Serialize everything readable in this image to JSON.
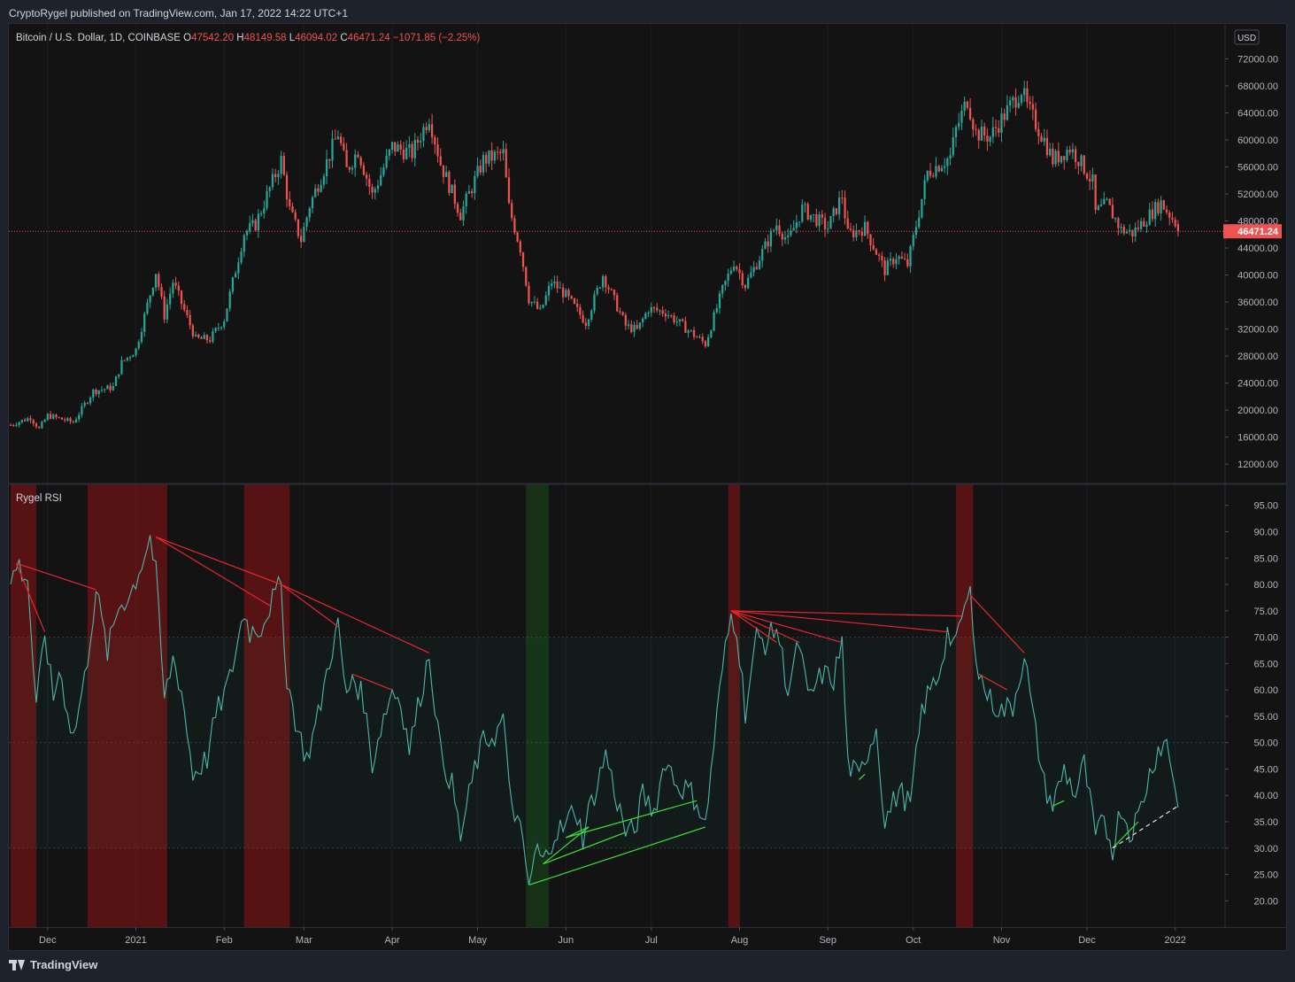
{
  "publish_line": "CryptoRygel published on TradingView.com, Jan 17, 2022 14:22 UTC+1",
  "footer_brand": "TradingView",
  "colors": {
    "up": "#26a69a",
    "down": "#ef5350",
    "rsi_line": "#4db6ac",
    "bear_div": "#e8262d",
    "bull_div": "#3be03b",
    "bg": "#131313"
  },
  "chart_data": [
    {
      "type": "candlestick",
      "symbol": "Bitcoin / U.S. Dollar, 1D, COINBASE",
      "ohlc_label": {
        "o": "47542.20",
        "h": "48149.58",
        "l": "46094.02",
        "c": "46471.24",
        "change": "−1071.85 (−2.25%)"
      },
      "currency": "USD",
      "last_price": "46471.24",
      "y_ticks": [
        "72000.00",
        "68000.00",
        "64000.00",
        "60000.00",
        "56000.00",
        "52000.00",
        "48000.00",
        "44000.00",
        "40000.00",
        "36000.00",
        "32000.00",
        "28000.00",
        "24000.00",
        "20000.00",
        "16000.00",
        "12000.00"
      ],
      "ylim": [
        11500,
        73500
      ],
      "x_range": [
        "2020-11-18",
        "2022-01-07"
      ],
      "anchors": [
        [
          "2020-11-18",
          17800
        ],
        [
          "2020-11-25",
          18900
        ],
        [
          "2020-11-28",
          17200
        ],
        [
          "2020-12-01",
          19200
        ],
        [
          "2020-12-10",
          18200
        ],
        [
          "2020-12-17",
          22800
        ],
        [
          "2020-12-24",
          23400
        ],
        [
          "2020-12-27",
          27000
        ],
        [
          "2021-01-01",
          29000
        ],
        [
          "2021-01-08",
          40500
        ],
        [
          "2021-01-11",
          34000
        ],
        [
          "2021-01-14",
          39000
        ],
        [
          "2021-01-22",
          30500
        ],
        [
          "2021-01-27",
          30500
        ],
        [
          "2021-02-01",
          33500
        ],
        [
          "2021-02-08",
          46200
        ],
        [
          "2021-02-12",
          47500
        ],
        [
          "2021-02-21",
          57000
        ],
        [
          "2021-02-24",
          49600
        ],
        [
          "2021-02-28",
          45200
        ],
        [
          "2021-03-03",
          50300
        ],
        [
          "2021-03-13",
          61000
        ],
        [
          "2021-03-16",
          55500
        ],
        [
          "2021-03-20",
          58500
        ],
        [
          "2021-03-25",
          51800
        ],
        [
          "2021-04-01",
          59000
        ],
        [
          "2021-04-08",
          58000
        ],
        [
          "2021-04-14",
          63500
        ],
        [
          "2021-04-18",
          56500
        ],
        [
          "2021-04-25",
          49000
        ],
        [
          "2021-05-03",
          57000
        ],
        [
          "2021-05-10",
          58000
        ],
        [
          "2021-05-12",
          50000
        ],
        [
          "2021-05-16",
          44000
        ],
        [
          "2021-05-19",
          36500
        ],
        [
          "2021-05-23",
          34500
        ],
        [
          "2021-05-27",
          39000
        ],
        [
          "2021-06-01",
          37000
        ],
        [
          "2021-06-08",
          33000
        ],
        [
          "2021-06-14",
          40000
        ],
        [
          "2021-06-22",
          32500
        ],
        [
          "2021-06-26",
          31800
        ],
        [
          "2021-06-30",
          35000
        ],
        [
          "2021-07-06",
          34500
        ],
        [
          "2021-07-20",
          29800
        ],
        [
          "2021-07-26",
          37800
        ],
        [
          "2021-07-30",
          42000
        ],
        [
          "2021-08-03",
          38500
        ],
        [
          "2021-08-14",
          47500
        ],
        [
          "2021-08-18",
          45000
        ],
        [
          "2021-08-23",
          49800
        ],
        [
          "2021-09-01",
          47000
        ],
        [
          "2021-09-06",
          51800
        ],
        [
          "2021-09-08",
          46000
        ],
        [
          "2021-09-14",
          47000
        ],
        [
          "2021-09-21",
          40700
        ],
        [
          "2021-09-25",
          42800
        ],
        [
          "2021-09-29",
          41500
        ],
        [
          "2021-10-06",
          55200
        ],
        [
          "2021-10-14",
          57500
        ],
        [
          "2021-10-16",
          61500
        ],
        [
          "2021-10-20",
          66000
        ],
        [
          "2021-10-23",
          61000
        ],
        [
          "2021-10-28",
          60500
        ],
        [
          "2021-11-08",
          67500
        ],
        [
          "2021-11-10",
          64900
        ],
        [
          "2021-11-16",
          60000
        ],
        [
          "2021-11-19",
          57000
        ],
        [
          "2021-11-25",
          58800
        ],
        [
          "2021-11-28",
          57200
        ],
        [
          "2021-12-03",
          53700
        ],
        [
          "2021-12-04",
          49200
        ],
        [
          "2021-12-08",
          50500
        ],
        [
          "2021-12-13",
          46700
        ],
        [
          "2021-12-17",
          46200
        ],
        [
          "2021-12-27",
          50700
        ],
        [
          "2022-01-01",
          47800
        ],
        [
          "2022-01-02",
          46471
        ]
      ]
    },
    {
      "type": "line",
      "title": "Rygel RSI",
      "y_ticks": [
        "95.00",
        "90.00",
        "85.00",
        "80.00",
        "75.00",
        "70.00",
        "65.00",
        "60.00",
        "55.00",
        "50.00",
        "45.00",
        "40.00",
        "35.00",
        "30.00",
        "25.00",
        "20.00"
      ],
      "ylim": [
        16.7,
        97.3
      ],
      "overbought": 70,
      "midline": 50,
      "oversold": 30,
      "x_ticks": [
        "Dec",
        "2021",
        "Feb",
        "Mar",
        "Apr",
        "May",
        "Jun",
        "Jul",
        "Aug",
        "Sep",
        "Oct",
        "Nov",
        "Dec",
        "2022"
      ],
      "x_tick_dates": [
        "2020-12-01",
        "2021-01-01",
        "2021-02-01",
        "2021-03-01",
        "2021-04-01",
        "2021-05-01",
        "2021-06-01",
        "2021-07-01",
        "2021-08-01",
        "2021-09-01",
        "2021-10-01",
        "2021-11-01",
        "2021-12-01",
        "2022-01-01"
      ],
      "anchors": [
        [
          "2020-11-18",
          80
        ],
        [
          "2020-11-20",
          84
        ],
        [
          "2020-11-24",
          81
        ],
        [
          "2020-11-27",
          56
        ],
        [
          "2020-11-30",
          71
        ],
        [
          "2020-12-03",
          58
        ],
        [
          "2020-12-05",
          64
        ],
        [
          "2020-12-10",
          51
        ],
        [
          "2020-12-14",
          62
        ],
        [
          "2020-12-18",
          79
        ],
        [
          "2020-12-22",
          67
        ],
        [
          "2020-12-26",
          76
        ],
        [
          "2020-12-30",
          78
        ],
        [
          "2021-01-03",
          84
        ],
        [
          "2021-01-06",
          89
        ],
        [
          "2021-01-08",
          82
        ],
        [
          "2021-01-11",
          58
        ],
        [
          "2021-01-14",
          66
        ],
        [
          "2021-01-17",
          60
        ],
        [
          "2021-01-21",
          44
        ],
        [
          "2021-01-26",
          47
        ],
        [
          "2021-01-29",
          55
        ],
        [
          "2021-02-03",
          62
        ],
        [
          "2021-02-08",
          75
        ],
        [
          "2021-02-10",
          71
        ],
        [
          "2021-02-14",
          72
        ],
        [
          "2021-02-17",
          76
        ],
        [
          "2021-02-21",
          80
        ],
        [
          "2021-02-23",
          62
        ],
        [
          "2021-02-27",
          52
        ],
        [
          "2021-03-02",
          47
        ],
        [
          "2021-03-06",
          55
        ],
        [
          "2021-03-10",
          66
        ],
        [
          "2021-03-13",
          72
        ],
        [
          "2021-03-16",
          58
        ],
        [
          "2021-03-18",
          63
        ],
        [
          "2021-03-22",
          58
        ],
        [
          "2021-03-25",
          46
        ],
        [
          "2021-03-28",
          53
        ],
        [
          "2021-04-01",
          60
        ],
        [
          "2021-04-04",
          58
        ],
        [
          "2021-04-07",
          49
        ],
        [
          "2021-04-11",
          59
        ],
        [
          "2021-04-14",
          67
        ],
        [
          "2021-04-18",
          48
        ],
        [
          "2021-04-22",
          42
        ],
        [
          "2021-04-25",
          32
        ],
        [
          "2021-04-30",
          45
        ],
        [
          "2021-05-03",
          50
        ],
        [
          "2021-05-08",
          52
        ],
        [
          "2021-05-10",
          55
        ],
        [
          "2021-05-12",
          41
        ],
        [
          "2021-05-16",
          33
        ],
        [
          "2021-05-19",
          23
        ],
        [
          "2021-05-22",
          30
        ],
        [
          "2021-05-24",
          27
        ],
        [
          "2021-05-28",
          33
        ],
        [
          "2021-06-01",
          34
        ],
        [
          "2021-06-04",
          38
        ],
        [
          "2021-06-07",
          32
        ],
        [
          "2021-06-09",
          37
        ],
        [
          "2021-06-12",
          42
        ],
        [
          "2021-06-15",
          48
        ],
        [
          "2021-06-18",
          41
        ],
        [
          "2021-06-22",
          33
        ],
        [
          "2021-06-25",
          33
        ],
        [
          "2021-06-28",
          40
        ],
        [
          "2021-07-02",
          37
        ],
        [
          "2021-07-06",
          47
        ],
        [
          "2021-07-10",
          42
        ],
        [
          "2021-07-14",
          41
        ],
        [
          "2021-07-17",
          39
        ],
        [
          "2021-07-20",
          34
        ],
        [
          "2021-07-23",
          50
        ],
        [
          "2021-07-26",
          64
        ],
        [
          "2021-07-29",
          74
        ],
        [
          "2021-07-31",
          72
        ],
        [
          "2021-08-03",
          56
        ],
        [
          "2021-08-07",
          70
        ],
        [
          "2021-08-10",
          69
        ],
        [
          "2021-08-14",
          72
        ],
        [
          "2021-08-18",
          60
        ],
        [
          "2021-08-22",
          69
        ],
        [
          "2021-08-25",
          58
        ],
        [
          "2021-08-30",
          63
        ],
        [
          "2021-09-03",
          62
        ],
        [
          "2021-09-06",
          69
        ],
        [
          "2021-09-08",
          46
        ],
        [
          "2021-09-12",
          43
        ],
        [
          "2021-09-14",
          47
        ],
        [
          "2021-09-18",
          53
        ],
        [
          "2021-09-21",
          35
        ],
        [
          "2021-09-26",
          41
        ],
        [
          "2021-09-30",
          38
        ],
        [
          "2021-10-04",
          56
        ],
        [
          "2021-10-07",
          60
        ],
        [
          "2021-10-10",
          63
        ],
        [
          "2021-10-13",
          71
        ],
        [
          "2021-10-16",
          68
        ],
        [
          "2021-10-18",
          74
        ],
        [
          "2021-10-21",
          78
        ],
        [
          "2021-10-24",
          63
        ],
        [
          "2021-10-28",
          58
        ],
        [
          "2021-11-01",
          56
        ],
        [
          "2021-11-05",
          57
        ],
        [
          "2021-11-09",
          67
        ],
        [
          "2021-11-12",
          55
        ],
        [
          "2021-11-16",
          42
        ],
        [
          "2021-11-19",
          38
        ],
        [
          "2021-11-23",
          45
        ],
        [
          "2021-11-27",
          40
        ],
        [
          "2021-11-30",
          46
        ],
        [
          "2021-12-04",
          32
        ],
        [
          "2021-12-07",
          35
        ],
        [
          "2021-12-10",
          30
        ],
        [
          "2021-12-13",
          38
        ],
        [
          "2021-12-16",
          33
        ],
        [
          "2021-12-19",
          36
        ],
        [
          "2021-12-23",
          44
        ],
        [
          "2021-12-26",
          49
        ],
        [
          "2021-12-29",
          50
        ],
        [
          "2022-01-01",
          42
        ],
        [
          "2022-01-02",
          38
        ]
      ],
      "overbought_zones": [
        [
          "2020-11-18",
          "2020-11-27"
        ],
        [
          "2020-12-15",
          "2021-01-12"
        ],
        [
          "2021-02-08",
          "2021-02-24"
        ],
        [
          "2021-07-28",
          "2021-08-01"
        ],
        [
          "2021-10-16",
          "2021-10-22"
        ]
      ],
      "oversold_zones": [
        [
          "2021-05-18",
          "2021-05-26"
        ]
      ],
      "bearish_divergences": [
        [
          [
            "2020-11-20",
            84
          ],
          [
            "2020-12-18",
            79
          ]
        ],
        [
          [
            "2020-11-20",
            84
          ],
          [
            "2020-11-30",
            71
          ]
        ],
        [
          [
            "2021-01-08",
            89
          ],
          [
            "2021-02-17",
            76
          ]
        ],
        [
          [
            "2021-01-08",
            89
          ],
          [
            "2021-02-21",
            80
          ]
        ],
        [
          [
            "2021-02-21",
            80
          ],
          [
            "2021-03-13",
            72
          ]
        ],
        [
          [
            "2021-02-21",
            80
          ],
          [
            "2021-04-14",
            67
          ]
        ],
        [
          [
            "2021-03-18",
            63
          ],
          [
            "2021-04-01",
            60
          ]
        ],
        [
          [
            "2021-07-29",
            75
          ],
          [
            "2021-08-14",
            69
          ]
        ],
        [
          [
            "2021-07-29",
            75
          ],
          [
            "2021-08-22",
            69
          ]
        ],
        [
          [
            "2021-07-29",
            75
          ],
          [
            "2021-09-06",
            69
          ]
        ],
        [
          [
            "2021-07-29",
            75
          ],
          [
            "2021-10-13",
            71
          ]
        ],
        [
          [
            "2021-07-29",
            75
          ],
          [
            "2021-10-18",
            74
          ]
        ],
        [
          [
            "2021-10-21",
            78
          ],
          [
            "2021-11-09",
            67
          ]
        ],
        [
          [
            "2021-10-24",
            63
          ],
          [
            "2021-11-03",
            60
          ]
        ]
      ],
      "bullish_divergences": [
        [
          [
            "2021-05-19",
            23
          ],
          [
            "2021-07-20",
            34
          ]
        ],
        [
          [
            "2021-05-24",
            27
          ],
          [
            "2021-06-22",
            33
          ]
        ],
        [
          [
            "2021-05-24",
            27
          ],
          [
            "2021-06-09",
            34
          ]
        ],
        [
          [
            "2021-06-01",
            32
          ],
          [
            "2021-06-09",
            34
          ]
        ],
        [
          [
            "2021-06-01",
            32
          ],
          [
            "2021-07-17",
            39
          ]
        ],
        [
          [
            "2021-09-12",
            43
          ],
          [
            "2021-09-14",
            44
          ]
        ],
        [
          [
            "2021-11-19",
            38
          ],
          [
            "2021-11-23",
            39
          ]
        ],
        [
          [
            "2021-12-10",
            30
          ],
          [
            "2021-12-19",
            35
          ]
        ]
      ],
      "pending_divergence": [
        [
          "2021-12-10",
          30
        ],
        [
          "2022-01-02",
          38
        ]
      ]
    }
  ]
}
